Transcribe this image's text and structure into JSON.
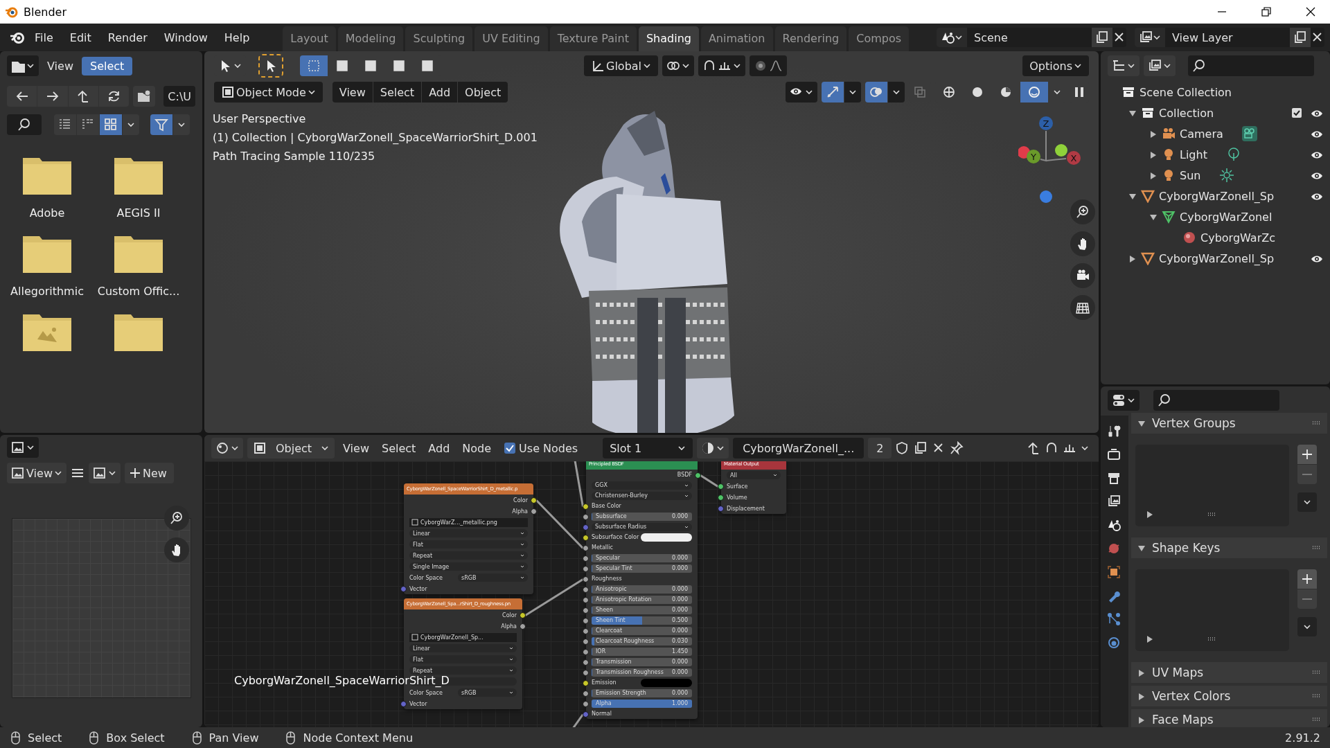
{
  "window": {
    "title": "Blender"
  },
  "menus": [
    "File",
    "Edit",
    "Render",
    "Window",
    "Help"
  ],
  "workspaces": [
    {
      "label": "Layout",
      "selected": false
    },
    {
      "label": "Modeling",
      "selected": false
    },
    {
      "label": "Sculpting",
      "selected": false
    },
    {
      "label": "UV Editing",
      "selected": false
    },
    {
      "label": "Texture Paint",
      "selected": false
    },
    {
      "label": "Shading",
      "selected": true
    },
    {
      "label": "Animation",
      "selected": false
    },
    {
      "label": "Rendering",
      "selected": false
    },
    {
      "label": "Compos",
      "selected": false
    }
  ],
  "scene": "Scene",
  "view_layer": "View Layer",
  "file_browser": {
    "menus": [
      {
        "label": "View",
        "selected": false
      },
      {
        "label": "Select",
        "selected": true
      }
    ],
    "path": "C:\\U",
    "display_modes": [
      {
        "selected": false
      },
      {
        "selected": false
      },
      {
        "selected": true
      }
    ],
    "filter_on": true,
    "items": [
      {
        "kind": "folder",
        "name": "Adobe"
      },
      {
        "kind": "folder",
        "name": "AEGIS II"
      },
      {
        "kind": "folder",
        "name": "Allegorithmic"
      },
      {
        "kind": "folder",
        "name": "Custom Offic..."
      },
      {
        "kind": "image-folder"
      },
      {
        "kind": "folder"
      }
    ]
  },
  "image_editor": {
    "view": "View",
    "new": "New"
  },
  "viewport": {
    "orientation": "Global",
    "options": "Options",
    "select_modes": [
      {
        "selected": true
      },
      {
        "selected": false
      },
      {
        "selected": false
      },
      {
        "selected": false
      },
      {
        "selected": false
      }
    ],
    "mode": "Object Mode",
    "menus": [
      "View",
      "Select",
      "Add",
      "Object"
    ],
    "gizmos_on": true,
    "overlays_on": true,
    "shading_modes": [
      {
        "selected": false
      },
      {
        "selected": false
      },
      {
        "selected": false
      },
      {
        "selected": true
      }
    ],
    "info": [
      "User Perspective",
      "(1) Collection | CyborgWarZonell_SpaceWarriorShirt_D.001",
      "Path Tracing Sample 110/235"
    ],
    "axes": [
      "Z",
      "Y",
      "X"
    ]
  },
  "node_editor": {
    "editor": "Object",
    "menus": [
      "View",
      "Select",
      "Add",
      "Node"
    ],
    "use_nodes": {
      "label": "Use Nodes",
      "checked": true
    },
    "slot": "Slot 1",
    "material": "CyborgWarZonell_...",
    "users": "2",
    "object_label": "CyborgWarZonell_SpaceWarriorShirt_D",
    "nodes": [
      {
        "kind": "image-texture",
        "title": "CyborgWarZonell_SpaceWarriorShirt_D_metallic.p",
        "outputs": [
          {
            "label": "Color",
            "socket": {
              "color": "#c7c729"
            }
          },
          {
            "label": "Alpha",
            "socket": {
              "color": "#a1a1a1"
            }
          }
        ],
        "image": "CyborgWarZ..._metallic.png",
        "options": [
          "Linear",
          "Flat",
          "Repeat",
          "Single Image"
        ],
        "color_space_label": "Color Space",
        "color_space": "sRGB",
        "inputs": [
          {
            "kind": "socket",
            "label": "Vector",
            "socket": {
              "color": "#6363c7"
            }
          }
        ]
      },
      {
        "kind": "image-texture",
        "title": "CyborgWarZonell_Spa...rShirt_D_roughness.pn",
        "outputs": [
          {
            "label": "Color",
            "socket": {
              "color": "#c7c729"
            }
          },
          {
            "label": "Alpha",
            "socket": {
              "color": "#a1a1a1"
            }
          }
        ],
        "image": "CyborgWarZonell_Sp...",
        "options": [
          "Linear",
          "Flat",
          "Repeat"
        ],
        "color_space_label": "Color Space",
        "color_space": "sRGB",
        "inputs": [
          {
            "kind": "socket",
            "label": "Vector",
            "socket": {
              "color": "#6363c7"
            }
          }
        ]
      },
      {
        "kind": "principled",
        "title": "Principled BSDF",
        "outputs": [
          {
            "label": "BSDF",
            "socket": {
              "color": "#4fc267"
            }
          }
        ],
        "options": [
          "GGX",
          "Christensen-Burley"
        ],
        "inputs": [
          {
            "kind": "socket",
            "label": "Base Color",
            "socket": {
              "color": "#c7c729"
            }
          },
          {
            "kind": "field",
            "label": "Subsurface",
            "socket": {
              "color": "#a1a1a1"
            },
            "value": "0.000",
            "level": 0
          },
          {
            "kind": "dropdown",
            "label": "Subsurface Radius",
            "socket": {
              "color": "#6363c7"
            }
          },
          {
            "kind": "color",
            "label": "Subsurface Color",
            "socket": {
              "color": "#c7c729"
            },
            "color": "#f0f0f0"
          },
          {
            "kind": "socket",
            "label": "Metallic",
            "socket": {
              "color": "#a1a1a1"
            }
          },
          {
            "kind": "field",
            "label": "Specular",
            "socket": {
              "color": "#a1a1a1"
            },
            "value": "0.000",
            "level": 0
          },
          {
            "kind": "field",
            "label": "Specular Tint",
            "socket": {
              "color": "#a1a1a1"
            },
            "value": "0.000",
            "level": 0
          },
          {
            "kind": "socket",
            "label": "Roughness",
            "socket": {
              "color": "#a1a1a1"
            }
          },
          {
            "kind": "field",
            "label": "Anisotropic",
            "socket": {
              "color": "#a1a1a1"
            },
            "value": "0.000",
            "level": 0
          },
          {
            "kind": "field",
            "label": "Anisotropic Rotation",
            "socket": {
              "color": "#a1a1a1"
            },
            "value": "0.000",
            "level": 0
          },
          {
            "kind": "field",
            "label": "Sheen",
            "socket": {
              "color": "#a1a1a1"
            },
            "value": "0.000",
            "level": 0
          },
          {
            "kind": "field",
            "label": "Sheen Tint",
            "socket": {
              "color": "#a1a1a1"
            },
            "value": "0.500",
            "level": 0.5
          },
          {
            "kind": "field",
            "label": "Clearcoat",
            "socket": {
              "color": "#a1a1a1"
            },
            "value": "0.000",
            "level": 0
          },
          {
            "kind": "field",
            "label": "Clearcoat Roughness",
            "socket": {
              "color": "#a1a1a1"
            },
            "value": "0.030",
            "level": 0.03
          },
          {
            "kind": "field",
            "label": "IOR",
            "socket": {
              "color": "#a1a1a1"
            },
            "value": "1.450",
            "level": 0
          },
          {
            "kind": "field",
            "label": "Transmission",
            "socket": {
              "color": "#a1a1a1"
            },
            "value": "0.000",
            "level": 0
          },
          {
            "kind": "field",
            "label": "Transmission Roughness",
            "socket": {
              "color": "#a1a1a1"
            },
            "value": "0.000",
            "level": 0
          },
          {
            "kind": "color",
            "label": "Emission",
            "socket": {
              "color": "#c7c729"
            },
            "color": "#000000"
          },
          {
            "kind": "field",
            "label": "Emission Strength",
            "socket": {
              "color": "#a1a1a1"
            },
            "value": "0.000",
            "level": 0
          },
          {
            "kind": "field",
            "label": "Alpha",
            "socket": {
              "color": "#a1a1a1"
            },
            "value": "1.000",
            "level": 1
          },
          {
            "kind": "socket",
            "label": "Normal",
            "socket": {
              "color": "#6363c7"
            }
          }
        ]
      },
      {
        "kind": "output",
        "title": "Material Output",
        "options": [
          "All"
        ],
        "inputs": [
          {
            "kind": "socket",
            "label": "Surface",
            "socket": {
              "color": "#4fc267"
            }
          },
          {
            "kind": "socket",
            "label": "Volume",
            "socket": {
              "color": "#4fc267"
            }
          },
          {
            "kind": "socket",
            "label": "Displacement",
            "socket": {
              "color": "#6363c7"
            }
          }
        ]
      }
    ]
  },
  "outliner": {
    "label": "Scene Collection",
    "children": [
      {
        "kind": "collection",
        "label": "Collection",
        "expanded": true,
        "checked": true,
        "eye": true,
        "children": [
          {
            "kind": "camera",
            "label": "Camera",
            "expanded": false,
            "eye": true
          },
          {
            "kind": "point-light",
            "label": "Light",
            "expanded": false,
            "eye": true
          },
          {
            "kind": "sun-light",
            "label": "Sun",
            "expanded": false,
            "eye": true
          }
        ]
      },
      {
        "kind": "mesh-object",
        "label": "CyborgWarZonell_Sp",
        "expanded": true,
        "eye": true,
        "children": [
          {
            "kind": "mesh",
            "label": "CyborgWarZonel",
            "expanded": true,
            "eye": false,
            "children": [
              {
                "kind": "material",
                "label": "CyborgWarZc",
                "eye": false
              }
            ]
          }
        ]
      },
      {
        "kind": "mesh-object",
        "label": "CyborgWarZonell_Sp",
        "expanded": false,
        "eye": true
      }
    ]
  },
  "properties": {
    "panels": [
      {
        "title": "Vertex Groups",
        "expanded": true
      },
      {
        "title": "Shape Keys",
        "expanded": true
      },
      {
        "title": "UV Maps",
        "expanded": false
      },
      {
        "title": "Vertex Colors",
        "expanded": false
      },
      {
        "title": "Face Maps",
        "expanded": false
      }
    ]
  },
  "status_bar": {
    "hints": [
      "Select",
      "Box Select",
      "Pan View",
      "Node Context Menu"
    ],
    "version": "2.91.2"
  }
}
